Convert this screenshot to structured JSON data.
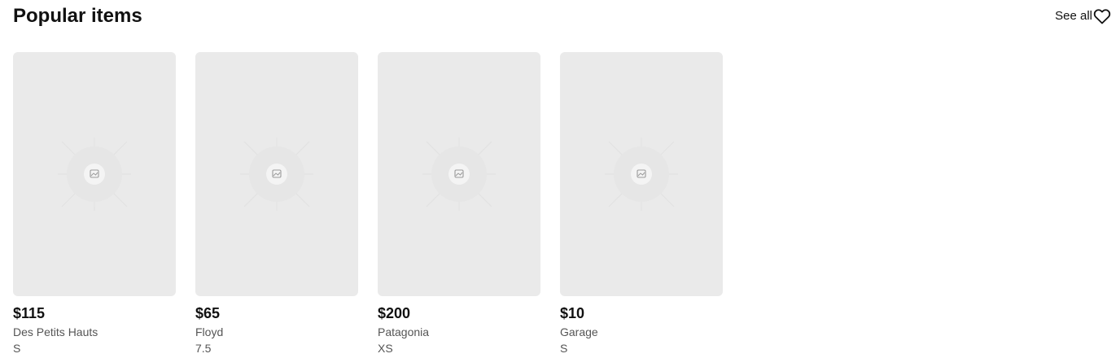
{
  "section": {
    "title": "Popular items",
    "see_all_label": "See all"
  },
  "items": [
    {
      "price": "$115",
      "brand": "Des Petits Hauts",
      "size": "S",
      "image_icon": "image-placeholder-icon"
    },
    {
      "price": "$65",
      "brand": "Floyd",
      "size": "7.5",
      "image_icon": "image-placeholder-icon"
    },
    {
      "price": "$200",
      "brand": "Patagonia",
      "size": "XS",
      "image_icon": "image-placeholder-icon"
    },
    {
      "price": "$10",
      "brand": "Garage",
      "size": "S",
      "image_icon": "image-placeholder-icon"
    }
  ],
  "colors": {
    "placeholder_bg": "#eaeaea",
    "text_primary": "#111111",
    "text_secondary": "#555555"
  }
}
